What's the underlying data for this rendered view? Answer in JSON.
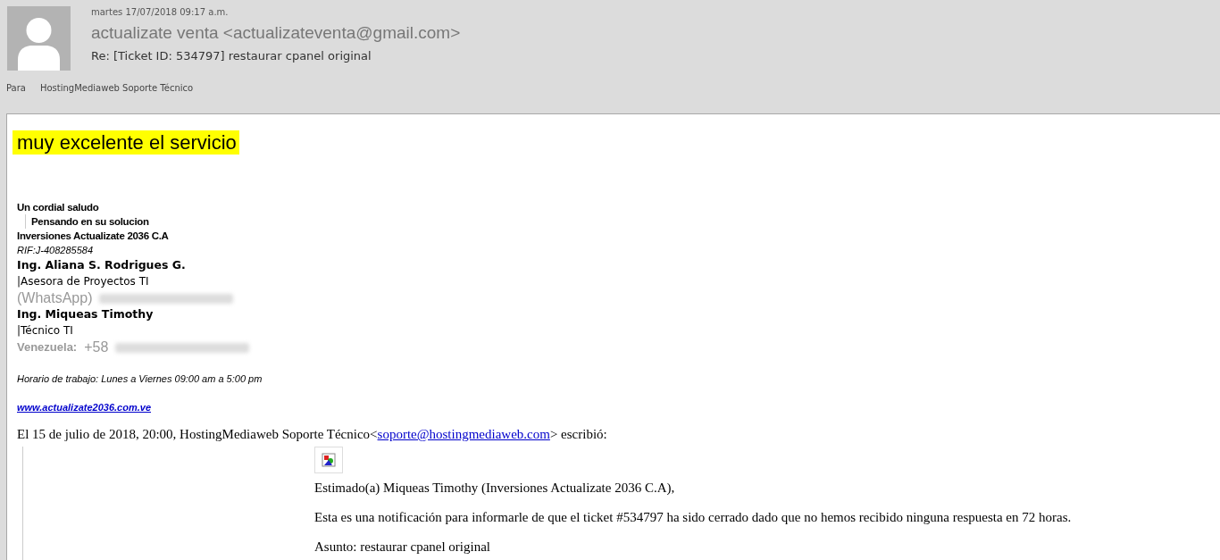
{
  "header": {
    "date": "martes 17/07/2018 09:17 a.m.",
    "sender": "actualizate venta <actualizateventa@gmail.com>",
    "subject": "Re: [Ticket ID: 534797] restaurar cpanel original",
    "to_label": "Para",
    "to": "HostingMediaweb Soporte Técnico"
  },
  "body": {
    "highlight": "muy excelente el servicio",
    "signature": [
      {
        "kind": "heading",
        "text": "Un cordial saludo"
      },
      {
        "kind": "indented",
        "text": "Pensando en su solucion"
      },
      {
        "kind": "heading",
        "text": "Inversiones Actualizate 2036 C.A"
      },
      {
        "kind": "italic",
        "text": "RIF:J-408285584"
      },
      {
        "kind": "name",
        "text": "Ing. Aliana S. Rodrigues G."
      },
      {
        "kind": "role",
        "text": "|Asesora de Proyectos TI"
      },
      {
        "kind": "contact",
        "text": "(WhatsApp)",
        "bold": false
      },
      {
        "kind": "name",
        "text": "Ing. Miqueas Timothy"
      },
      {
        "kind": "role",
        "text": "|Técnico TI"
      },
      {
        "kind": "contact",
        "text": "Venezuela:",
        "bold": true,
        "prefix": "+58"
      },
      {
        "kind": "hours",
        "text": "Horario de trabajo: Lunes a Viernes 09:00 am a 5:00 pm"
      },
      {
        "kind": "link",
        "text": "www.actualizate2036.com.ve"
      }
    ],
    "reply_intro": {
      "before": "El 15 de julio de 2018, 20:00, HostingMediaweb Soporte Técnico<",
      "link": "soporte@hostingmediaweb.com",
      "after": "> escribió:"
    },
    "quoted": [
      "Estimado(a) Miqueas Timothy (Inversiones Actualizate 2036 C.A),",
      "Esta es una notificación para informarle de que el ticket #534797 ha sido cerrado dado que no hemos recibido ninguna respuesta en 72 horas.",
      "Asunto: restaurar cpanel original"
    ]
  }
}
